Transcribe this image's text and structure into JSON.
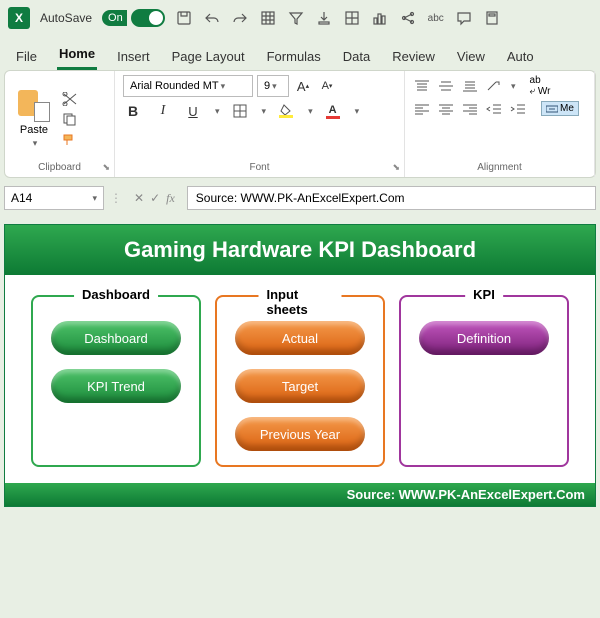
{
  "titlebar": {
    "autosave_label": "AutoSave",
    "autosave_state": "On"
  },
  "tabs": {
    "file": "File",
    "home": "Home",
    "insert": "Insert",
    "page_layout": "Page Layout",
    "formulas": "Formulas",
    "data": "Data",
    "review": "Review",
    "view": "View",
    "automate": "Auto"
  },
  "ribbon": {
    "clipboard": {
      "label": "Clipboard",
      "paste": "Paste"
    },
    "font": {
      "label": "Font",
      "name": "Arial Rounded MT",
      "size": "9",
      "bold": "B",
      "italic": "I",
      "underline": "U"
    },
    "alignment": {
      "label": "Alignment",
      "merge": "Me",
      "wrap": "Wr"
    }
  },
  "formula_bar": {
    "cell_ref": "A14",
    "fx": "fx",
    "value": "Source: WWW.PK-AnExcelExpert.Com"
  },
  "dashboard": {
    "title": "Gaming Hardware KPI Dashboard",
    "panels": [
      {
        "label": "Dashboard",
        "buttons": [
          "Dashboard",
          "KPI Trend"
        ]
      },
      {
        "label": "Input sheets",
        "buttons": [
          "Actual",
          "Target",
          "Previous Year"
        ]
      },
      {
        "label": "KPI",
        "buttons": [
          "Definition"
        ]
      }
    ],
    "footer": "Source: WWW.PK-AnExcelExpert.Com"
  }
}
